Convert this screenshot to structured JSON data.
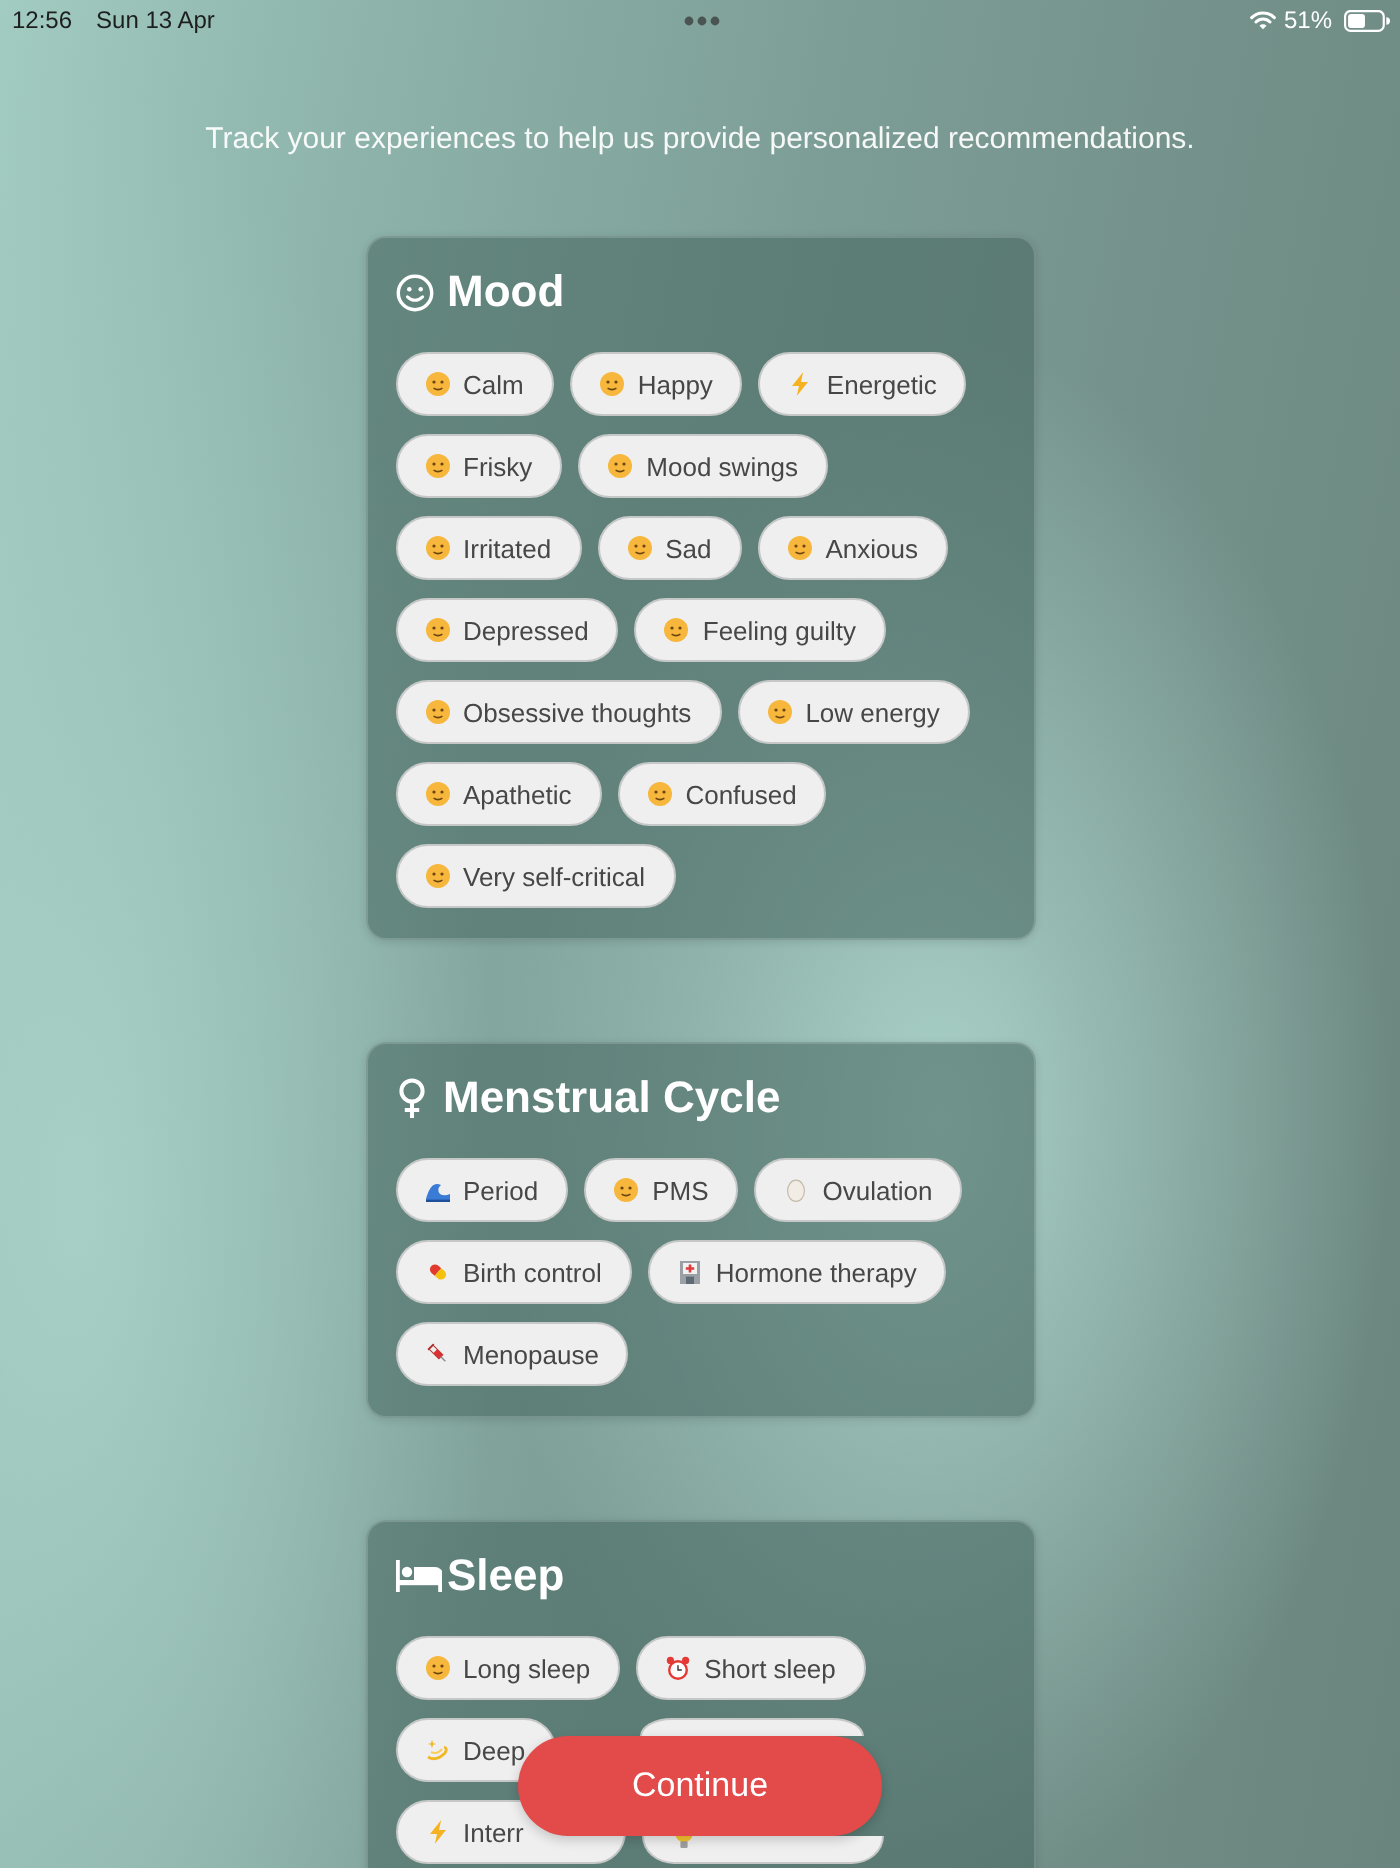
{
  "status_bar": {
    "time": "12:56",
    "date": "Sun 13 Apr",
    "battery": "51%"
  },
  "subtitle": "Track your experiences to help us provide personalized recommendations.",
  "sections": [
    {
      "title": "Mood",
      "kind": "smiley",
      "chips": [
        {
          "label": "Calm",
          "kind": "face",
          "selected": false
        },
        {
          "label": "Happy",
          "kind": "face",
          "selected": false
        },
        {
          "label": "Energetic",
          "kind": "bolt",
          "selected": false
        },
        {
          "label": "Frisky",
          "kind": "face",
          "selected": false
        },
        {
          "label": "Mood swings",
          "kind": "face",
          "selected": false
        },
        {
          "label": "Irritated",
          "kind": "face",
          "selected": false
        },
        {
          "label": "Sad",
          "kind": "face",
          "selected": false
        },
        {
          "label": "Anxious",
          "kind": "face",
          "selected": false
        },
        {
          "label": "Depressed",
          "kind": "face",
          "selected": false
        },
        {
          "label": "Feeling guilty",
          "kind": "face",
          "selected": false
        },
        {
          "label": "Obsessive thoughts",
          "kind": "face",
          "selected": false
        },
        {
          "label": "Low energy",
          "kind": "face",
          "selected": false
        },
        {
          "label": "Apathetic",
          "kind": "face",
          "selected": false
        },
        {
          "label": "Confused",
          "kind": "face",
          "selected": false
        },
        {
          "label": "Very self-critical",
          "kind": "face",
          "selected": false
        }
      ]
    },
    {
      "title": "Menstrual Cycle",
      "kind": "female",
      "chips": [
        {
          "label": "Period",
          "kind": "wave",
          "selected": false
        },
        {
          "label": "PMS",
          "kind": "face",
          "selected": false
        },
        {
          "label": "Ovulation",
          "kind": "egg",
          "selected": false
        },
        {
          "label": "Birth control",
          "kind": "pill",
          "selected": false
        },
        {
          "label": "Hormone therapy",
          "kind": "hospital",
          "selected": false
        },
        {
          "label": "Menopause",
          "kind": "syringe",
          "selected": false
        }
      ]
    },
    {
      "title": "Sleep",
      "kind": "bed",
      "chips": [
        {
          "label": "Long sleep",
          "kind": "face",
          "selected": false
        },
        {
          "label": "Short sleep",
          "kind": "alarm",
          "selected": false
        },
        {
          "label": "Deep",
          "kind": "swirl",
          "selected": false
        },
        {
          "selected": false
        },
        {
          "label": "Interr",
          "kind": "bolt",
          "selected": false
        },
        {
          "kind": "bulb",
          "selected": false
        }
      ]
    }
  ],
  "continue_button": {
    "label": "Continue"
  }
}
